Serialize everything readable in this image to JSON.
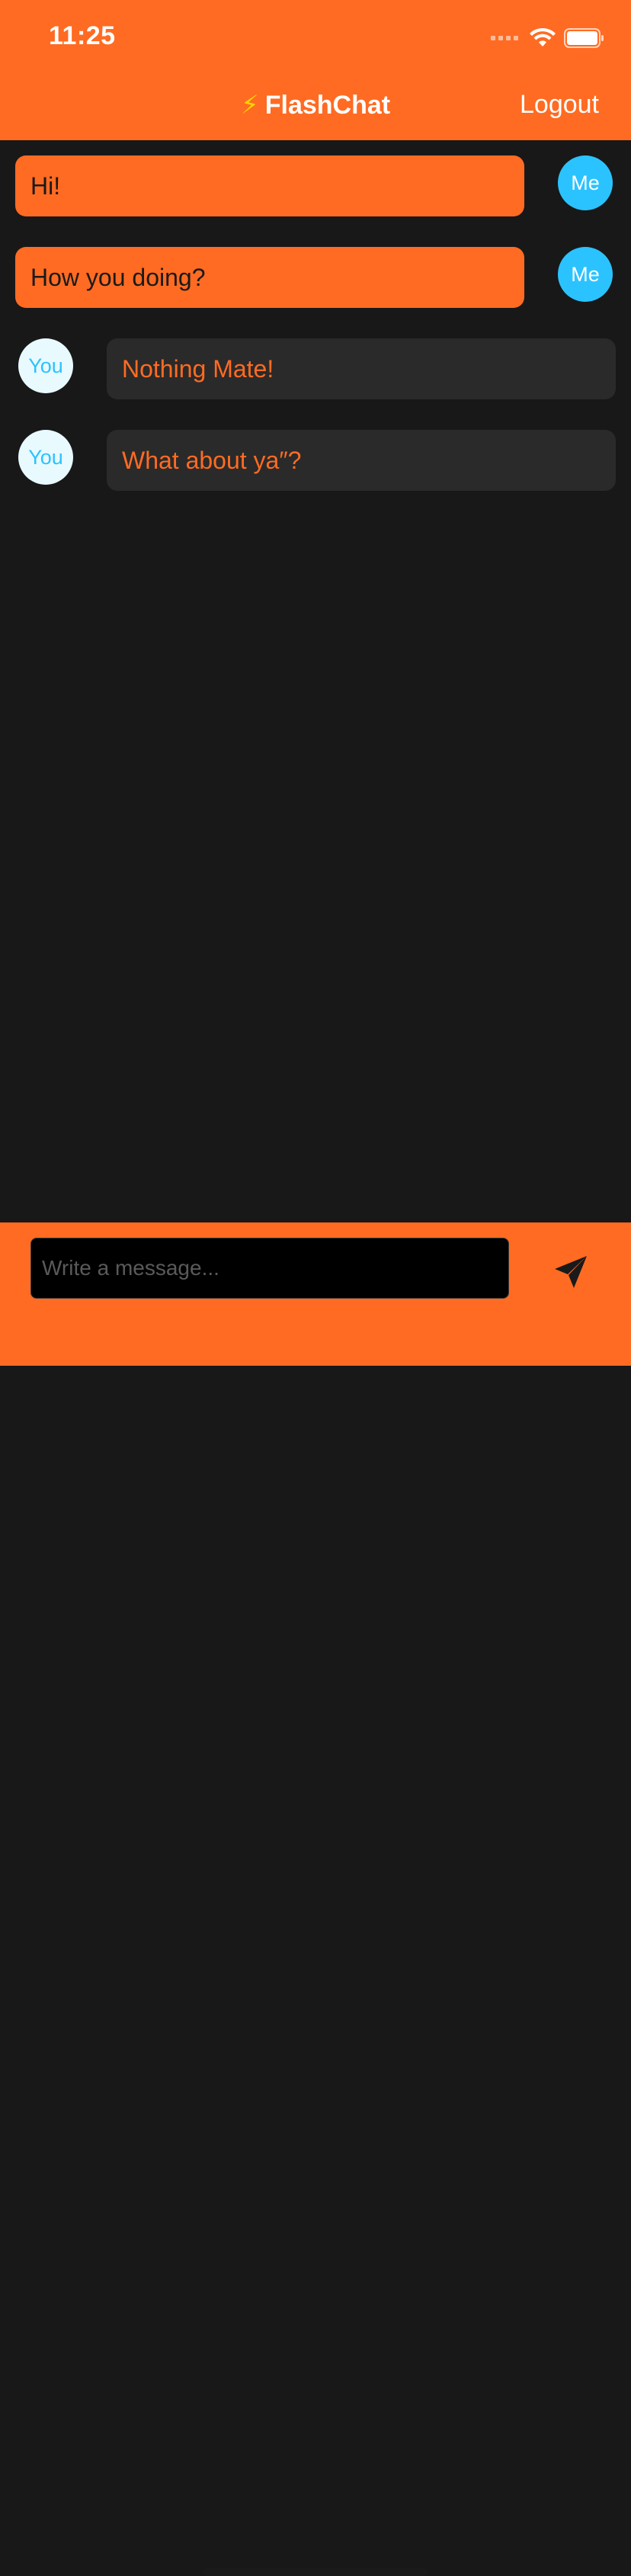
{
  "status_bar": {
    "time": "11:25"
  },
  "nav": {
    "title": "FlashChat",
    "title_icon": "lightning-bolt",
    "logout_label": "Logout"
  },
  "messages": [
    {
      "sender": "me",
      "avatar_label": "Me",
      "text": "Hi!"
    },
    {
      "sender": "me",
      "avatar_label": "Me",
      "text": "How you doing?"
    },
    {
      "sender": "you",
      "avatar_label": "You",
      "text": "Nothing Mate!"
    },
    {
      "sender": "you",
      "avatar_label": "You",
      "text": "What about ya″?"
    }
  ],
  "composer": {
    "placeholder": "Write a message...",
    "value": "",
    "send_icon": "paperplane-icon"
  },
  "colors": {
    "brand_orange": "#FF6B22",
    "background": "#181818",
    "incoming_bubble": "#2A2A2A",
    "me_avatar": "#2BC3FF",
    "you_avatar": "#E9FAFF"
  }
}
